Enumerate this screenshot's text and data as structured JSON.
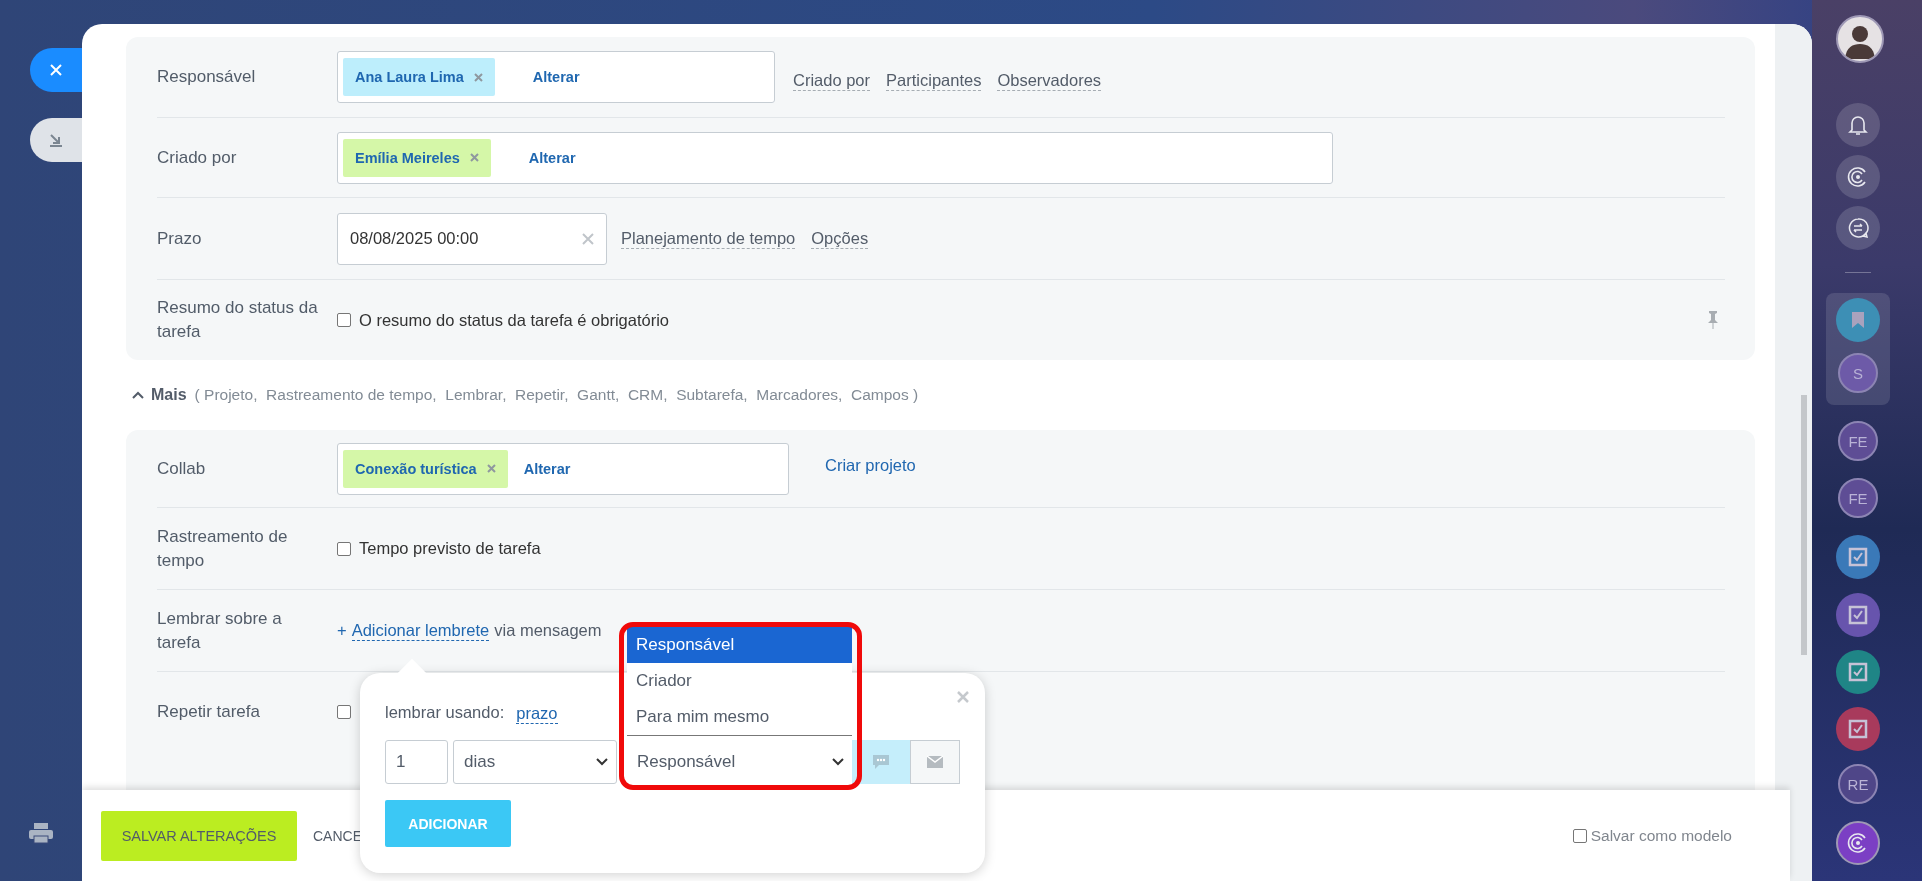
{
  "fields": [
    {
      "kind": "people",
      "label": "Responsável",
      "tags": [
        {
          "text": "Ana Laura Lima",
          "color": "#bdeefc"
        }
      ],
      "action": "Alterar",
      "links": [
        "Criado por",
        "Participantes",
        "Observadores"
      ]
    },
    {
      "kind": "people",
      "label": "Criado por",
      "tags": [
        {
          "text": "Emília Meireles",
          "color": "#d5f7a8"
        }
      ],
      "action": "Alterar"
    },
    {
      "kind": "date",
      "label": "Prazo",
      "value": "08/08/2025 00:00",
      "links": [
        "Planejamento de tempo",
        "Opções"
      ]
    },
    {
      "kind": "checkbox",
      "label": "Resumo do status da tarefa",
      "text": "O resumo do status da tarefa é obrigatório",
      "checked": false,
      "pin": true
    }
  ],
  "more": {
    "toggle": "Mais",
    "expanded": true,
    "list": "( Projeto,  Rastreamento de tempo,  Lembrar,  Repetir,  Gantt,  CRM,  Subtarefa,  Marcadores,  Campos )"
  },
  "extra_fields": [
    {
      "kind": "people",
      "label": "Collab",
      "tags": [
        {
          "text": "Conexão turística",
          "color": "#d5f7a8"
        }
      ],
      "action": "Alterar",
      "link": "Criar projeto"
    },
    {
      "kind": "checkbox",
      "label": "Rastreamento de tempo",
      "text": "Tempo previsto de tarefa",
      "checked": false
    },
    {
      "kind": "reminder",
      "label": "Lembrar sobre a tarefa",
      "prefix": "+",
      "link": "Adicionar lembrete",
      "suffix": "via mensagem"
    },
    {
      "kind": "checkbox",
      "label": "Repetir tarefa",
      "checked": false
    }
  ],
  "reminder_popup": {
    "using_label": "lembrar usando:",
    "using_link": "prazo",
    "amount": "1",
    "unit": "dias",
    "recipient": "Responsável",
    "options": [
      {
        "label": "Responsável",
        "selected": true
      },
      {
        "label": "Criador",
        "selected": false
      },
      {
        "label": "Para mim mesmo",
        "selected": false
      }
    ],
    "channels": [
      {
        "kind": "chat",
        "selected": true
      },
      {
        "kind": "mail",
        "selected": false
      }
    ],
    "button": "ADICIONAR"
  },
  "footer": {
    "save": "SALVAR ALTERAÇÕES",
    "cancel": "CANCE",
    "template": {
      "label": "Salvar como modelo",
      "checked": false
    }
  },
  "right_bar": [
    {
      "kind": "photo"
    },
    {
      "kind": "bell"
    },
    {
      "kind": "spiral"
    },
    {
      "kind": "exchange"
    },
    {
      "kind": "bookmark",
      "color": "#3d8fb5",
      "group": true
    },
    {
      "kind": "initials",
      "text": "S",
      "color": "#6d5aa8",
      "group": true
    },
    {
      "kind": "initials",
      "text": "FE",
      "color": "#5e4d95"
    },
    {
      "kind": "initials",
      "text": "FE",
      "color": "#5e4d95"
    },
    {
      "kind": "task",
      "color": "#3a79b8"
    },
    {
      "kind": "task",
      "color": "#6754ad"
    },
    {
      "kind": "task",
      "color": "#1f8586"
    },
    {
      "kind": "task",
      "color": "#a83a5c"
    },
    {
      "kind": "initials",
      "text": "RE",
      "color": "#4f4688"
    },
    {
      "kind": "spiral",
      "color": "#7b3fc4"
    }
  ]
}
